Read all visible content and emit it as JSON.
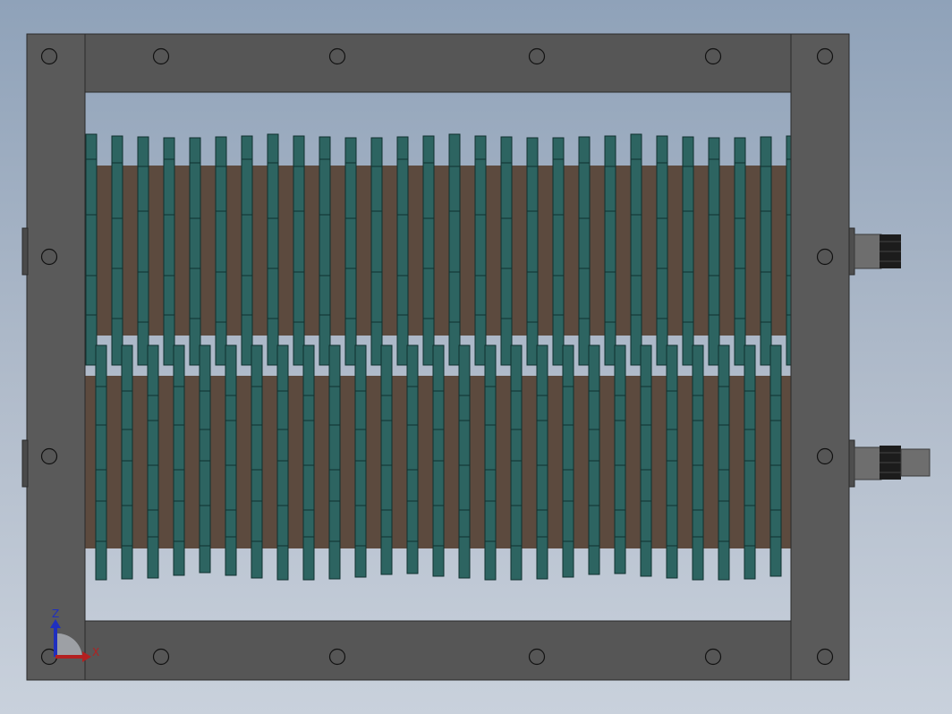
{
  "scene": {
    "kind": "CAD front view – twin-shaft shredder assembly",
    "background_top": "#8fa2b9",
    "background_bottom": "#c9d1dc",
    "frame_color": "#565656",
    "frame_edge": "#2a2a2a",
    "shaft_color": "#5c4a3e",
    "blade_color": "#2d6461",
    "blade_edge": "#10302e",
    "fitting_color": "#6b6b6b",
    "fitting_thread_color": "#1c1c1c"
  },
  "triad": {
    "z_label": "Z",
    "x_label": "X",
    "z_color": "#1f2fbf",
    "x_color": "#b32020"
  }
}
